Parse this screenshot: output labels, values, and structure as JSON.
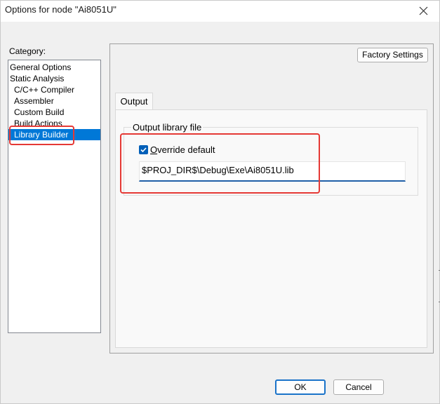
{
  "window": {
    "title": "Options for node \"Ai8051U\""
  },
  "category": {
    "label": "Category:",
    "items": [
      {
        "label": "General Options"
      },
      {
        "label": "Static Analysis"
      },
      {
        "label": "C/C++ Compiler"
      },
      {
        "label": "Assembler"
      },
      {
        "label": "Custom Build"
      },
      {
        "label": "Build Actions"
      },
      {
        "label": "Library Builder"
      }
    ],
    "selected": "Library Builder"
  },
  "panel": {
    "factory_settings": "Factory Settings",
    "tabs": [
      {
        "label": "Output"
      }
    ],
    "group_title": "Output library file",
    "override_label_u": "O",
    "override_label_rest": "verride default",
    "override_checked": true,
    "output_path": "$PROJ_DIR$\\Debug\\Exe\\Ai8051U.lib"
  },
  "buttons": {
    "ok": "OK",
    "cancel": "Cancel"
  },
  "colors": {
    "selection": "#0078d7",
    "highlight": "#e53935",
    "accent": "#005fb8"
  }
}
